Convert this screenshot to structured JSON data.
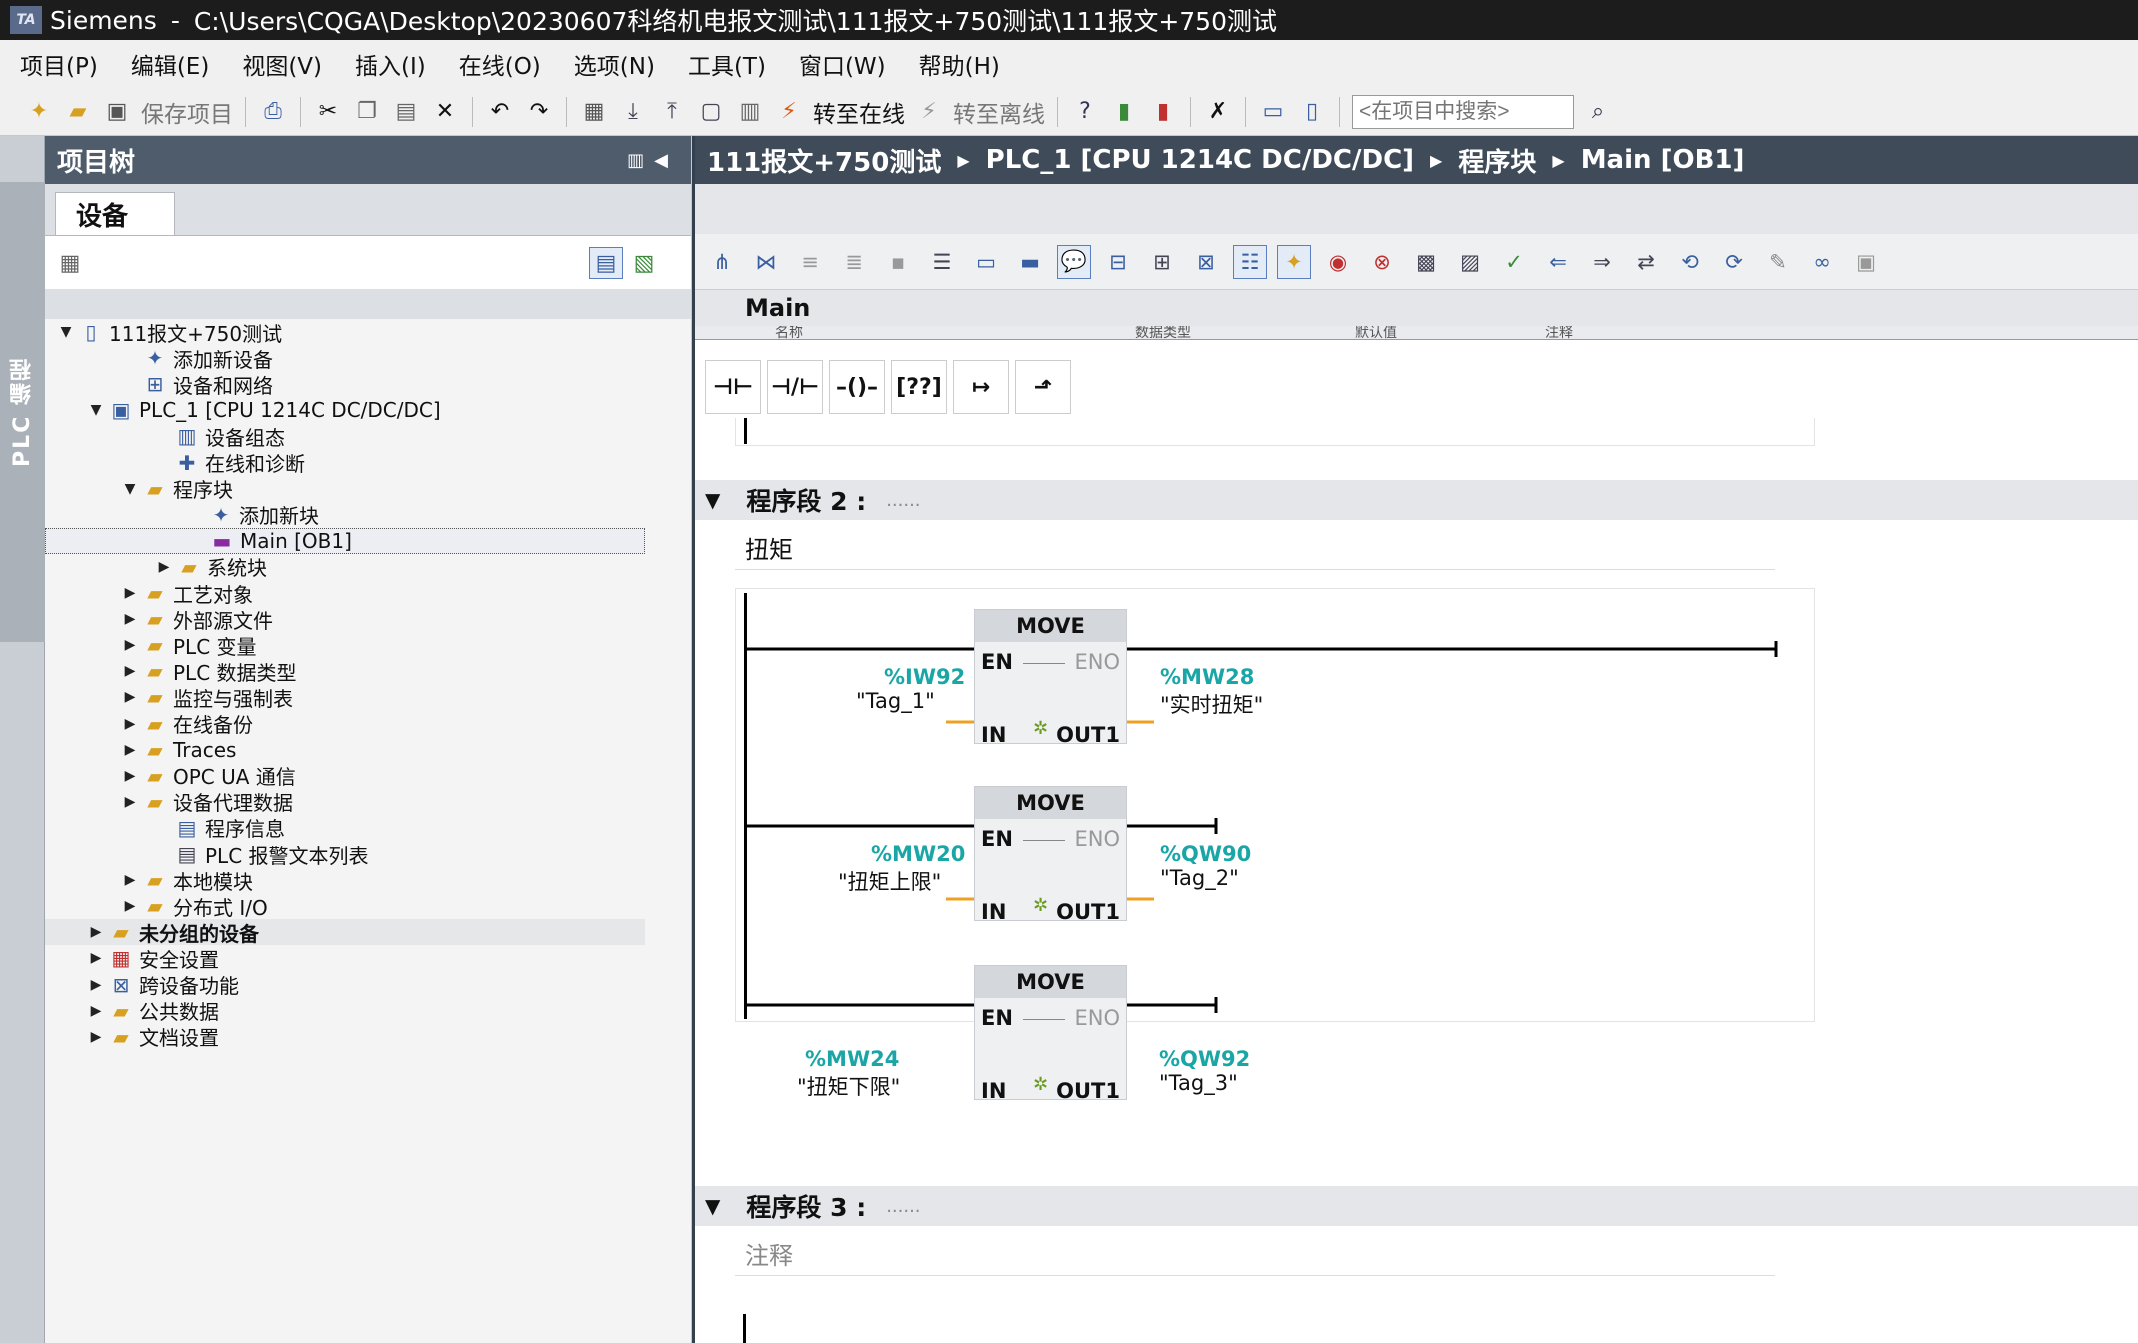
{
  "window": {
    "app": "Siemens",
    "separator": "-",
    "path": "C:\\Users\\CQGA\\Desktop\\20230607科络机电报文测试\\111报文+750测试\\111报文+750测试"
  },
  "menu": [
    "项目(P)",
    "编辑(E)",
    "视图(V)",
    "插入(I)",
    "在线(O)",
    "选项(N)",
    "工具(T)",
    "窗口(W)",
    "帮助(H)"
  ],
  "toolbar": {
    "save_project": "保存项目",
    "go_online": "转至在线",
    "go_offline": "转至离线",
    "search_placeholder": "<在项目中搜索>"
  },
  "side_tab": "PLC 编程",
  "project_tree": {
    "title": "项目树",
    "tab": "设备",
    "items": [
      {
        "label": "111报文+750测试",
        "icon": "project-icon"
      },
      {
        "label": "添加新设备",
        "icon": "add-device-icon"
      },
      {
        "label": "设备和网络",
        "icon": "network-icon"
      },
      {
        "label": "PLC_1 [CPU 1214C DC/DC/DC]",
        "icon": "plc-icon"
      },
      {
        "label": "设备组态",
        "icon": "device-config-icon"
      },
      {
        "label": "在线和诊断",
        "icon": "diagnostics-icon"
      },
      {
        "label": "程序块",
        "icon": "folder-icon"
      },
      {
        "label": "添加新块",
        "icon": "add-block-icon"
      },
      {
        "label": "Main [OB1]",
        "icon": "ob-block-icon"
      },
      {
        "label": "系统块",
        "icon": "folder-icon"
      },
      {
        "label": "工艺对象",
        "icon": "folder-icon"
      },
      {
        "label": "外部源文件",
        "icon": "folder-icon"
      },
      {
        "label": "PLC 变量",
        "icon": "folder-icon"
      },
      {
        "label": "PLC 数据类型",
        "icon": "folder-icon"
      },
      {
        "label": "监控与强制表",
        "icon": "folder-icon"
      },
      {
        "label": "在线备份",
        "icon": "folder-icon"
      },
      {
        "label": "Traces",
        "icon": "folder-icon"
      },
      {
        "label": "OPC UA 通信",
        "icon": "folder-icon"
      },
      {
        "label": "设备代理数据",
        "icon": "folder-icon"
      },
      {
        "label": "程序信息",
        "icon": "program-info-icon"
      },
      {
        "label": "PLC 报警文本列表",
        "icon": "list-icon"
      },
      {
        "label": "本地模块",
        "icon": "folder-icon"
      },
      {
        "label": "分布式 I/O",
        "icon": "folder-icon"
      },
      {
        "label": "未分组的设备",
        "icon": "folder-icon"
      },
      {
        "label": "安全设置",
        "icon": "security-icon"
      },
      {
        "label": "跨设备功能",
        "icon": "cross-device-icon"
      },
      {
        "label": "公共数据",
        "icon": "folder-icon"
      },
      {
        "label": "文档设置",
        "icon": "folder-icon"
      }
    ]
  },
  "breadcrumb": [
    "111报文+750测试",
    "PLC_1 [CPU 1214C DC/DC/DC]",
    "程序块",
    "Main [OB1]"
  ],
  "block_name": "Main",
  "interface_headers": [
    "名称",
    "数据类型",
    "默认值",
    "注释"
  ],
  "networks": [
    {
      "title": "程序段 2 :",
      "dots": "......",
      "comment": "扭矩",
      "moves": [
        {
          "instruction": "MOVE",
          "en": "EN",
          "eno": "ENO",
          "in": "IN",
          "out": "OUT1",
          "in_addr": "%IW92",
          "in_tag": "\"Tag_1\"",
          "out_addr": "%MW28",
          "out_tag": "\"实时扭矩\""
        },
        {
          "instruction": "MOVE",
          "en": "EN",
          "eno": "ENO",
          "in": "IN",
          "out": "OUT1",
          "in_addr": "%MW20",
          "in_tag": "\"扭矩上限\"",
          "out_addr": "%QW90",
          "out_tag": "\"Tag_2\""
        },
        {
          "instruction": "MOVE",
          "en": "EN",
          "eno": "ENO",
          "in": "IN",
          "out": "OUT1",
          "in_addr": "%MW24",
          "in_tag": "\"扭矩下限\"",
          "out_addr": "%QW92",
          "out_tag": "\"Tag_3\""
        }
      ]
    },
    {
      "title": "程序段 3 :",
      "dots": "......",
      "comment": "注释"
    }
  ],
  "colors": {
    "header_bg": "#4f5c6b",
    "breadcrumb_bg": "#3f4b58",
    "address": "#1aa6a6",
    "wire_orange": "#f0a020"
  }
}
